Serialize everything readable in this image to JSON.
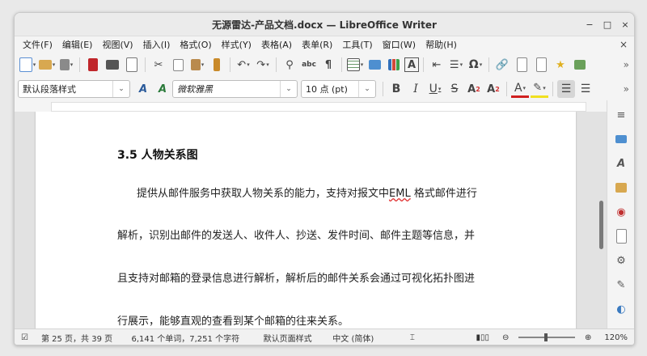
{
  "window": {
    "title": "无源雷达-产品文档.docx — LibreOffice Writer",
    "controls": {
      "minimize": "−",
      "maximize": "□",
      "close": "×"
    }
  },
  "menu": {
    "items": [
      "文件(F)",
      "编辑(E)",
      "视图(V)",
      "插入(I)",
      "格式(O)",
      "样式(Y)",
      "表格(A)",
      "表单(R)",
      "工具(T)",
      "窗口(W)",
      "帮助(H)"
    ],
    "close_doc": "×"
  },
  "format_bar": {
    "paragraph_style": "默认段落样式",
    "font_name": "微软雅黑",
    "font_size": "10 点 (pt)"
  },
  "document": {
    "heading": "3.5 人物关系图",
    "lines": [
      {
        "pre": "提供从邮件服务中获取人物关系的能力，支持对报文中",
        "mark": "EML",
        "post": " 格式邮件进行"
      },
      {
        "pre": "解析，识别出邮件的发送人、收件人、抄送、发件时间、邮件主题等信息，并",
        "mark": "",
        "post": ""
      },
      {
        "pre": "且支持对邮箱的登录信息进行解析，解析后的邮件关系会通过可视化拓扑图进",
        "mark": "",
        "post": ""
      },
      {
        "pre": "行展示，能够直观的查看到某个邮箱的往来关系。",
        "mark": "",
        "post": ""
      }
    ]
  },
  "status": {
    "page": "第 25 页，共 39 页",
    "words": "6,141 个单词，7,251 个字符",
    "page_style": "默认页面样式",
    "language": "中文 (简体)",
    "zoom": "120%"
  },
  "colors": {
    "accent": "#e03030",
    "chart_bar": "#2f6fba"
  }
}
